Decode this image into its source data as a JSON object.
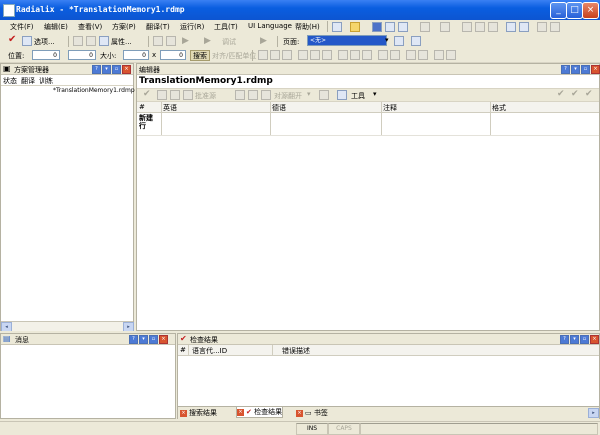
{
  "window": {
    "title": "Radialix - *TranslationMemory1.rdmp",
    "minimize": "_",
    "maximize": "□",
    "close": "×"
  },
  "menu": [
    "文件(F)",
    "编辑(E)",
    "查看(V)",
    "方案(P)",
    "翻译(T)",
    "运行(R)",
    "工具(T)",
    "UI Language",
    "帮助(H)"
  ],
  "toolbar2": {
    "options": "选项...",
    "attributes": "属性...",
    "debug": "调试",
    "view_label": "页面:",
    "view_dropdown": "<无>"
  },
  "toolbar3": {
    "position_label": "位置:",
    "position_value": "0",
    "position_value2": "0",
    "size_label": "大小:",
    "size_value": "0",
    "size_x": "x",
    "size_value2": "0",
    "search": "搜索",
    "align_units": "对齐/匹配单位"
  },
  "solution_explorer": {
    "title": "方案管理器",
    "columns": [
      "状态",
      "翻译",
      "训练"
    ],
    "items": [
      "*TranslationMemory1.rdmp"
    ]
  },
  "editor": {
    "panel_title": "编辑器",
    "doc_title": "TranslationMemory1.rdmp",
    "toolbar": {
      "confirm": "批准源",
      "expand": "对源翻开",
      "tools": "工具"
    },
    "columns": [
      "#",
      "英语",
      "德语",
      "注释",
      "格式"
    ],
    "row_header": "新建行"
  },
  "messages": {
    "title": "消息"
  },
  "check_results": {
    "title": "检查结果",
    "columns": [
      "#",
      "语言代...ID",
      "错误描述"
    ],
    "tabs": [
      "搜索结果",
      "检查结果",
      "书签"
    ]
  },
  "statusbar": {
    "ins": "INS",
    "caps": "CAPS"
  },
  "colors": {
    "titlebar": "#0a5ee0",
    "background": "#ece9d8",
    "selection": "#2458c8"
  }
}
